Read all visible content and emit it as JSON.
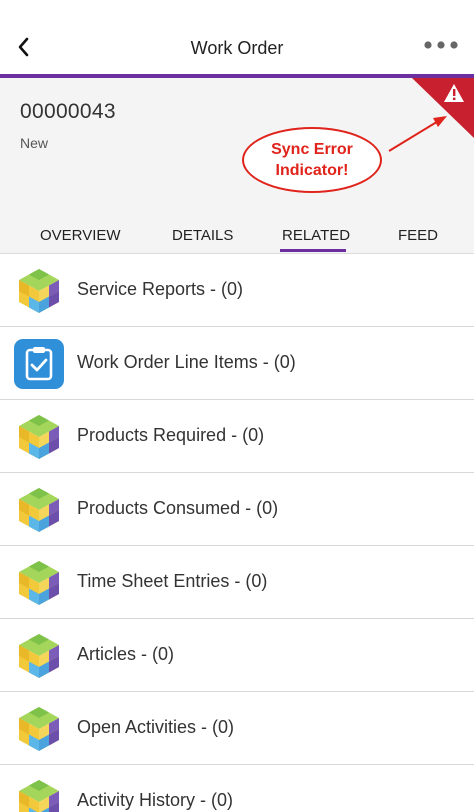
{
  "nav": {
    "title": "Work Order",
    "back_icon": "chevron-left-icon",
    "more_icon": "more-horizontal-icon"
  },
  "colors": {
    "accent": "#6b2fa0",
    "sync_error": "#c8202e",
    "callout": "#e0231b",
    "tile_blue": "#2f8fd8"
  },
  "record": {
    "number": "00000043",
    "status": "New"
  },
  "callout": {
    "text": "Sync Error\nIndicator!"
  },
  "tabs": [
    {
      "label": "OVERVIEW",
      "selected": false
    },
    {
      "label": "DETAILS",
      "selected": false
    },
    {
      "label": "RELATED",
      "selected": true
    },
    {
      "label": "FEED",
      "selected": false
    }
  ],
  "related_lists": [
    {
      "label": "Service Reports - (0)",
      "icon": "cube-icon"
    },
    {
      "label": "Work Order Line Items - (0)",
      "icon": "clipboard-check-icon"
    },
    {
      "label": "Products Required - (0)",
      "icon": "cube-icon"
    },
    {
      "label": "Products Consumed - (0)",
      "icon": "cube-icon"
    },
    {
      "label": "Time Sheet Entries - (0)",
      "icon": "cube-icon"
    },
    {
      "label": "Articles - (0)",
      "icon": "cube-icon"
    },
    {
      "label": "Open Activities - (0)",
      "icon": "cube-icon"
    },
    {
      "label": "Activity History - (0)",
      "icon": "cube-icon"
    }
  ]
}
